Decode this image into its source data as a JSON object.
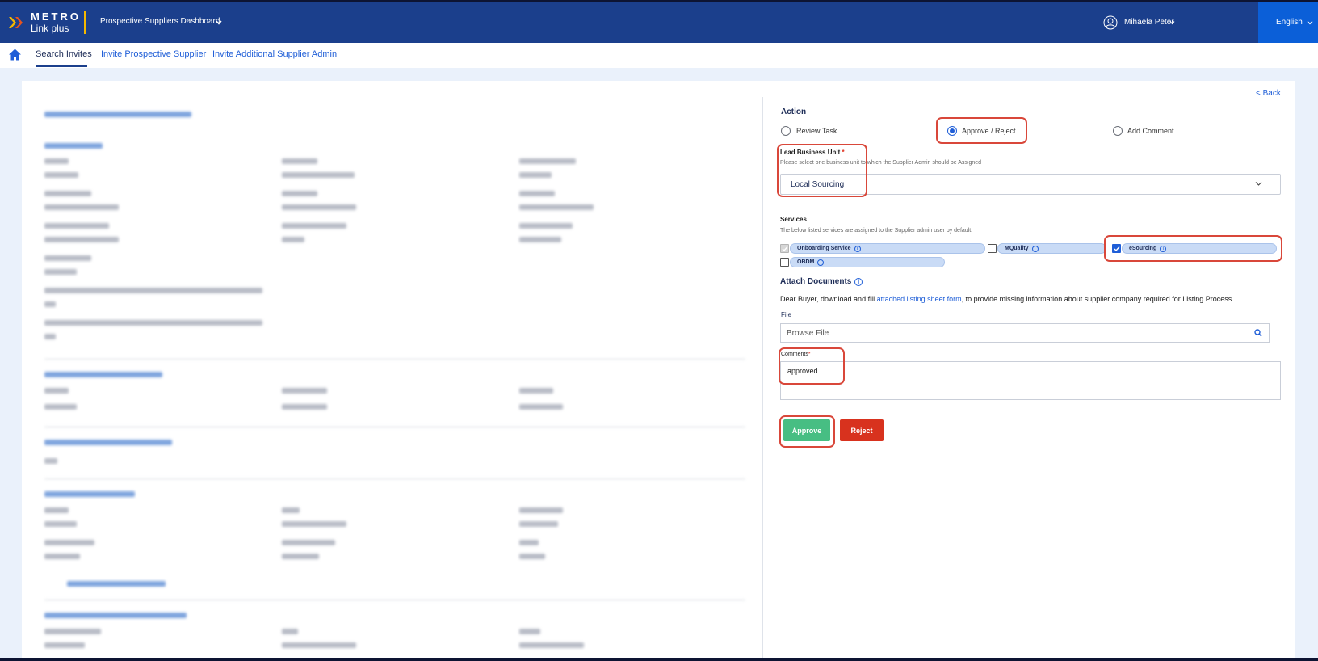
{
  "header": {
    "logo_line1": "METRO",
    "logo_line2": "Link plus",
    "dashboard_title": "Prospective Suppliers Dashboard",
    "user_name": "Mihaela Peter",
    "language": "English",
    "colors": {
      "brand": "#1b3f8c",
      "accent": "#f5b800",
      "language_bg": "#0b5fd8"
    }
  },
  "nav": {
    "items": [
      {
        "label": "Search Invites",
        "active": true
      },
      {
        "label": "Invite Prospective Supplier",
        "active": false
      },
      {
        "label": "Invite Additional Supplier Admin",
        "active": false
      }
    ]
  },
  "back_label": "< Back",
  "action": {
    "title": "Action",
    "options": [
      {
        "label": "Review Task",
        "selected": false
      },
      {
        "label": "Approve / Reject",
        "selected": true
      },
      {
        "label": "Add Comment",
        "selected": false
      }
    ]
  },
  "lead_business_unit": {
    "label": "Lead Business Unit",
    "required_mark": "*",
    "hint": "Please select one business unit to which the Supplier Admin should be Assigned",
    "value": "Local Sourcing"
  },
  "services": {
    "title": "Services",
    "hint": "The below listed services are assigned to the Supplier admin user by default.",
    "items": [
      {
        "label": "Onboarding Service",
        "checked": true,
        "disabled": true
      },
      {
        "label": "MQuality",
        "checked": false,
        "disabled": false
      },
      {
        "label": "eSourcing",
        "checked": true,
        "disabled": false
      },
      {
        "label": "OBDM",
        "checked": false,
        "disabled": false
      }
    ]
  },
  "attach": {
    "title": "Attach Documents",
    "text_before": "Dear Buyer, download and fill ",
    "link": "attached listing sheet form",
    "text_after": ", to provide missing information about supplier company required for Listing Process.",
    "file_label": "File",
    "file_placeholder": "Browse File",
    "comments_label": "Comments",
    "comments_required": "*",
    "comments_value": "approved"
  },
  "buttons": {
    "approve": "Approve",
    "reject": "Reject"
  }
}
